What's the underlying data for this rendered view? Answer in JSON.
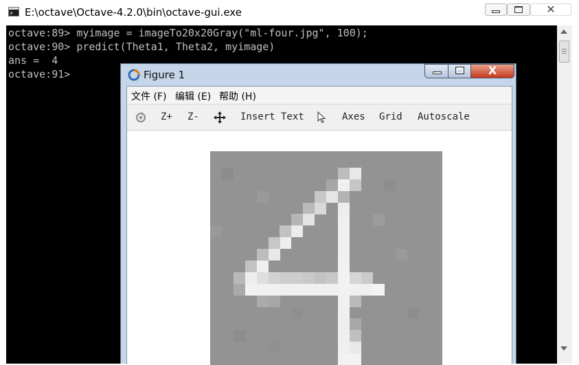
{
  "console_window": {
    "title": "E:\\octave\\Octave-4.2.0\\bin\\octave-gui.exe",
    "minimize_icon": "minimize-icon",
    "maximize_icon": "maximize-icon",
    "close_icon": "close-icon",
    "close_glyph": "✕",
    "lines": [
      "octave:89> myimage = imageTo20x20Gray(\"ml-four.jpg\", 100);",
      "octave:90> predict(Theta1, Theta2, myimage)",
      "ans =  4",
      "octave:91>"
    ]
  },
  "figure_window": {
    "title": "Figure 1",
    "close_glyph": "X",
    "menu": [
      "文件 (F)",
      "编辑 (E)",
      "帮助 (H)"
    ],
    "toolbar": {
      "rotate_icon": "rotate-icon",
      "zoom_in": "Z+",
      "zoom_out": "Z-",
      "pan_icon": "pan-move-icon",
      "insert_text": "Insert Text",
      "select_icon": "pointer-select-icon",
      "axes": "Axes",
      "grid": "Grid",
      "autoscale": "Autoscale"
    },
    "image_description_colors": {
      "background_gray": "#939393",
      "stroke_white": "#f2f2f2"
    }
  }
}
